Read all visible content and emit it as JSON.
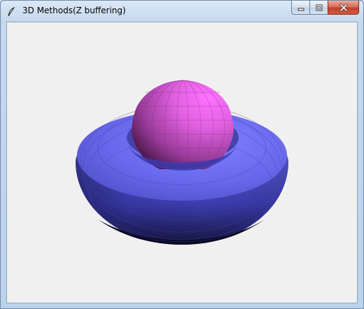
{
  "window": {
    "title": "3D Methods(Z buffering)",
    "icon": "feather-icon"
  },
  "caption_buttons": {
    "minimize_icon": "minimize-icon",
    "maximize_icon": "maximize-icon",
    "close_icon": "close-icon"
  },
  "colors": {
    "canvas_background": "#f0f0f0",
    "torus_color": "#6666ee",
    "sphere_color": "#ee66ee"
  }
}
